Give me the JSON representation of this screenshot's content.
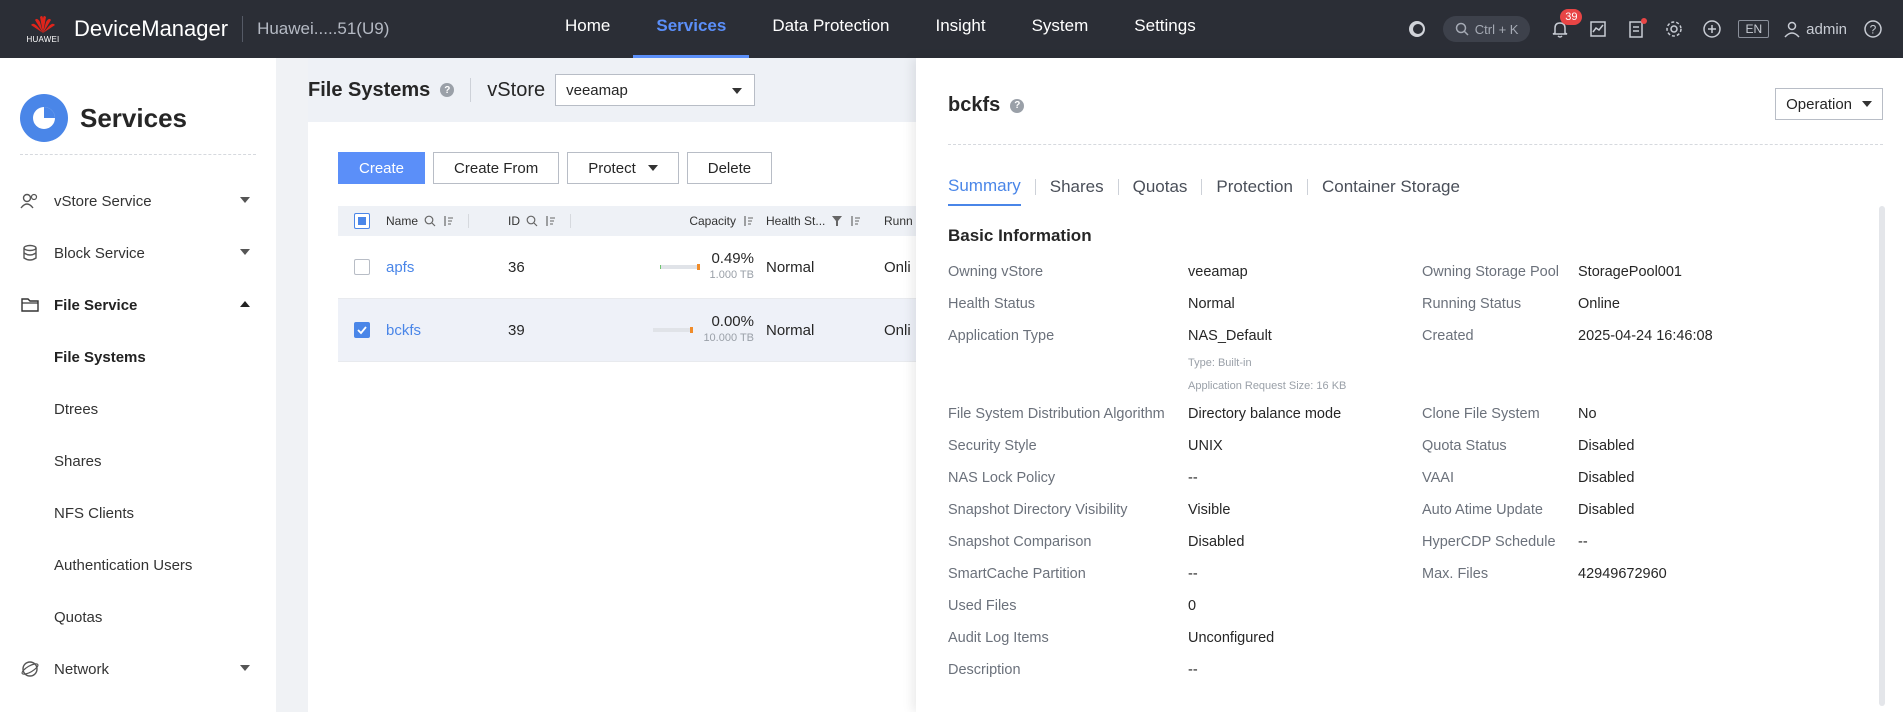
{
  "topbar": {
    "logo_text": "HUAWEI",
    "brand": "DeviceManager",
    "device": "Huawei.....51(U9)",
    "nav": [
      {
        "label": "Home"
      },
      {
        "label": "Services"
      },
      {
        "label": "Data Protection"
      },
      {
        "label": "Insight"
      },
      {
        "label": "System"
      },
      {
        "label": "Settings"
      }
    ],
    "search_hint": "Ctrl + K",
    "alarm_count": "39",
    "lang": "EN",
    "user": "admin"
  },
  "sidebar": {
    "title": "Services",
    "items": [
      {
        "label": "vStore Service"
      },
      {
        "label": "Block Service"
      },
      {
        "label": "File Service"
      }
    ],
    "sub_items": [
      {
        "label": "File Systems"
      },
      {
        "label": "Dtrees"
      },
      {
        "label": "Shares"
      },
      {
        "label": "NFS Clients"
      },
      {
        "label": "Authentication Users"
      },
      {
        "label": "Quotas"
      }
    ],
    "network": "Network"
  },
  "main": {
    "title": "File Systems",
    "vstore_label": "vStore",
    "vstore_value": "veeamap",
    "actions": {
      "create": "Create",
      "create_from": "Create From",
      "protect": "Protect",
      "delete": "Delete"
    },
    "columns": {
      "name": "Name",
      "id": "ID",
      "capacity": "Capacity",
      "health": "Health St...",
      "running": "Runn"
    },
    "rows": [
      {
        "name": "apfs",
        "id": "36",
        "capacity_pct": "0.49%",
        "capacity_total": "1.000 TB",
        "used_fraction": 0.0049,
        "health": "Normal",
        "running": "Onli"
      },
      {
        "name": "bckfs",
        "id": "39",
        "capacity_pct": "0.00%",
        "capacity_total": "10.000 TB",
        "used_fraction": 0.0,
        "health": "Normal",
        "running": "Onli"
      }
    ]
  },
  "panel": {
    "title": "bckfs",
    "operation": "Operation",
    "tabs": [
      "Summary",
      "Shares",
      "Quotas",
      "Protection",
      "Container Storage"
    ],
    "section": "Basic Information",
    "left": [
      {
        "label": "Owning vStore",
        "value": "veeamap"
      },
      {
        "label": "Health Status",
        "value": "Normal"
      },
      {
        "label": "Application Type",
        "value": "NAS_Default",
        "sub1": "Type: Built-in",
        "sub2": "Application Request Size: 16 KB"
      },
      {
        "label": "File System Distribution Algorithm",
        "value": "Directory balance mode"
      },
      {
        "label": "Security Style",
        "value": "UNIX"
      },
      {
        "label": "NAS Lock Policy",
        "value": "--"
      },
      {
        "label": "Snapshot Directory Visibility",
        "value": "Visible"
      },
      {
        "label": "Snapshot Comparison",
        "value": "Disabled"
      },
      {
        "label": "SmartCache Partition",
        "value": "--"
      },
      {
        "label": "Used Files",
        "value": "0"
      },
      {
        "label": "Audit Log Items",
        "value": "Unconfigured"
      },
      {
        "label": "Description",
        "value": "--"
      }
    ],
    "right": [
      {
        "label": "Owning Storage Pool",
        "value": "StoragePool001"
      },
      {
        "label": "Running Status",
        "value": "Online"
      },
      {
        "label": "Created",
        "value": "2025-04-24 16:46:08"
      },
      {
        "label": "Clone File System",
        "value": "No"
      },
      {
        "label": "Quota Status",
        "value": "Disabled"
      },
      {
        "label": "VAAI",
        "value": "Disabled"
      },
      {
        "label": "Auto Atime Update",
        "value": "Disabled"
      },
      {
        "label": "HyperCDP Schedule",
        "value": "--"
      },
      {
        "label": "Max. Files",
        "value": "42949672960"
      }
    ]
  },
  "colors": {
    "accent": "#4a86e8",
    "topbar": "#2b2e36",
    "alarm": "#e84545"
  }
}
